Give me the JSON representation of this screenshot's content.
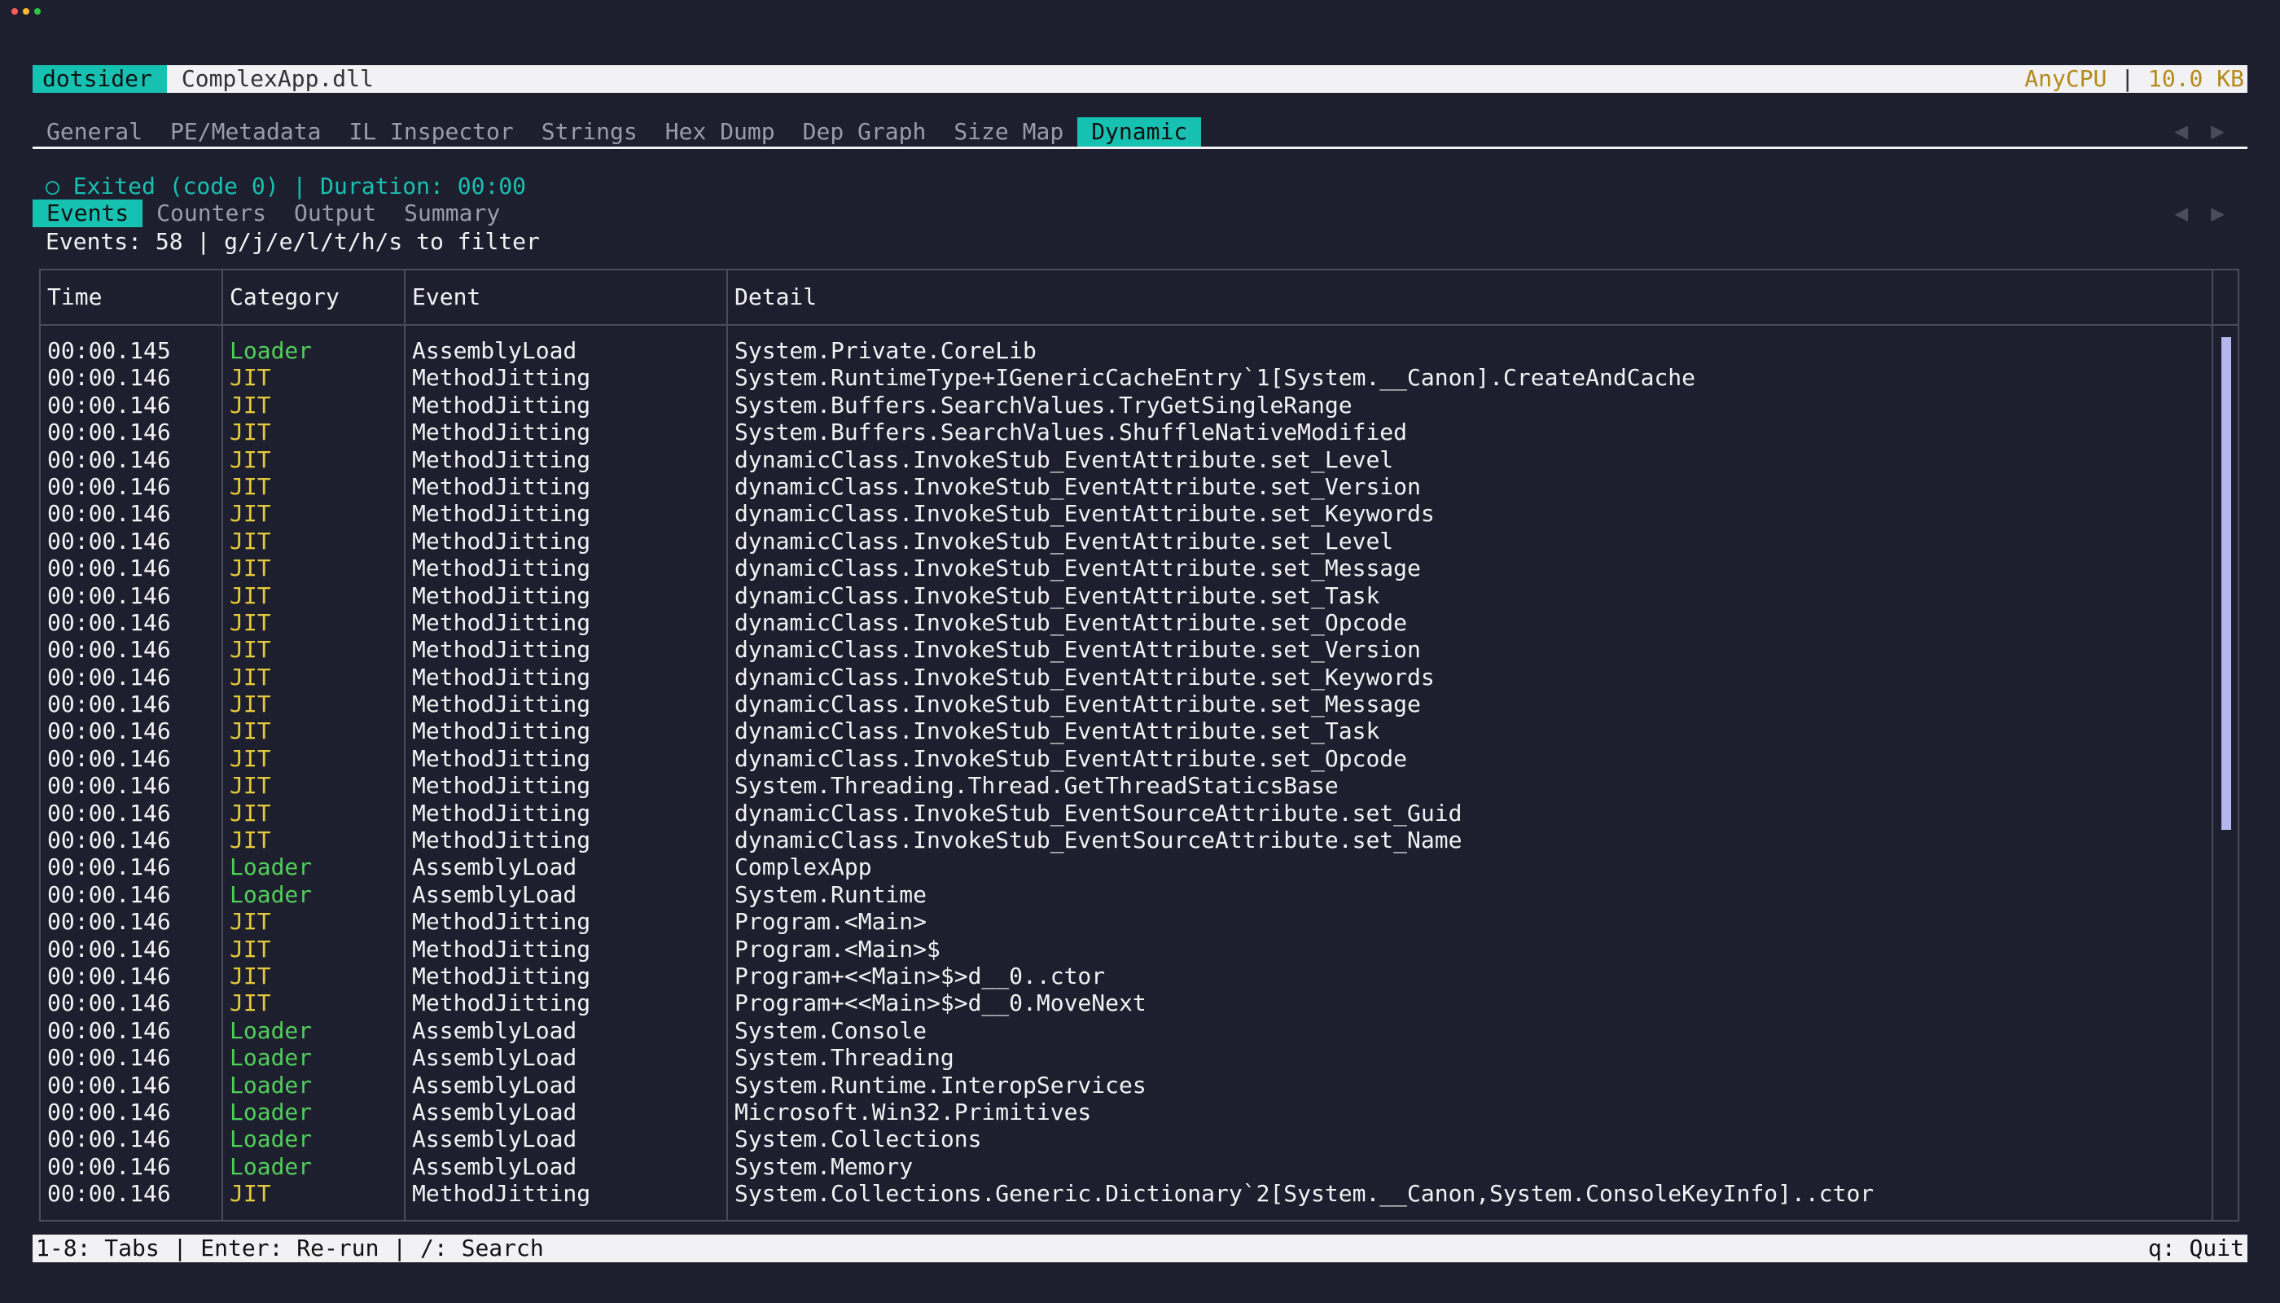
{
  "window": {
    "lights": [
      {
        "name": "close",
        "color": "#ff5f57"
      },
      {
        "name": "minimize",
        "color": "#febc2e"
      },
      {
        "name": "maximize",
        "color": "#28c840"
      }
    ]
  },
  "titlebar": {
    "app": "dotsider",
    "file": "ComplexApp.dll",
    "platform": "AnyCPU",
    "separator": "|",
    "size": "10.0 KB"
  },
  "tabs": [
    {
      "label": "General",
      "active": false
    },
    {
      "label": "PE/Metadata",
      "active": false
    },
    {
      "label": "IL Inspector",
      "active": false
    },
    {
      "label": "Strings",
      "active": false
    },
    {
      "label": "Hex Dump",
      "active": false
    },
    {
      "label": "Dep Graph",
      "active": false
    },
    {
      "label": "Size Map",
      "active": false
    },
    {
      "label": "Dynamic",
      "active": true
    }
  ],
  "nav_arrows": {
    "left": "◀",
    "right": "▶"
  },
  "status": "○ Exited (code 0) | Duration: 00:00",
  "subtabs": [
    {
      "label": "Events",
      "active": true
    },
    {
      "label": "Counters",
      "active": false
    },
    {
      "label": "Output",
      "active": false
    },
    {
      "label": "Summary",
      "active": false
    }
  ],
  "events_info": "Events: 58 | g/j/e/l/t/h/s to filter",
  "table": {
    "headers": {
      "time": "Time",
      "category": "Category",
      "event": "Event",
      "detail": "Detail"
    },
    "rows": [
      [
        "00:00.145",
        "Loader",
        "AssemblyLoad",
        "System.Private.CoreLib"
      ],
      [
        "00:00.146",
        "JIT",
        "MethodJitting",
        "System.RuntimeType+IGenericCacheEntry`1[System.__Canon].CreateAndCache"
      ],
      [
        "00:00.146",
        "JIT",
        "MethodJitting",
        "System.Buffers.SearchValues.TryGetSingleRange"
      ],
      [
        "00:00.146",
        "JIT",
        "MethodJitting",
        "System.Buffers.SearchValues.ShuffleNativeModified"
      ],
      [
        "00:00.146",
        "JIT",
        "MethodJitting",
        "dynamicClass.InvokeStub_EventAttribute.set_Level"
      ],
      [
        "00:00.146",
        "JIT",
        "MethodJitting",
        "dynamicClass.InvokeStub_EventAttribute.set_Version"
      ],
      [
        "00:00.146",
        "JIT",
        "MethodJitting",
        "dynamicClass.InvokeStub_EventAttribute.set_Keywords"
      ],
      [
        "00:00.146",
        "JIT",
        "MethodJitting",
        "dynamicClass.InvokeStub_EventAttribute.set_Level"
      ],
      [
        "00:00.146",
        "JIT",
        "MethodJitting",
        "dynamicClass.InvokeStub_EventAttribute.set_Message"
      ],
      [
        "00:00.146",
        "JIT",
        "MethodJitting",
        "dynamicClass.InvokeStub_EventAttribute.set_Task"
      ],
      [
        "00:00.146",
        "JIT",
        "MethodJitting",
        "dynamicClass.InvokeStub_EventAttribute.set_Opcode"
      ],
      [
        "00:00.146",
        "JIT",
        "MethodJitting",
        "dynamicClass.InvokeStub_EventAttribute.set_Version"
      ],
      [
        "00:00.146",
        "JIT",
        "MethodJitting",
        "dynamicClass.InvokeStub_EventAttribute.set_Keywords"
      ],
      [
        "00:00.146",
        "JIT",
        "MethodJitting",
        "dynamicClass.InvokeStub_EventAttribute.set_Message"
      ],
      [
        "00:00.146",
        "JIT",
        "MethodJitting",
        "dynamicClass.InvokeStub_EventAttribute.set_Task"
      ],
      [
        "00:00.146",
        "JIT",
        "MethodJitting",
        "dynamicClass.InvokeStub_EventAttribute.set_Opcode"
      ],
      [
        "00:00.146",
        "JIT",
        "MethodJitting",
        "System.Threading.Thread.GetThreadStaticsBase"
      ],
      [
        "00:00.146",
        "JIT",
        "MethodJitting",
        "dynamicClass.InvokeStub_EventSourceAttribute.set_Guid"
      ],
      [
        "00:00.146",
        "JIT",
        "MethodJitting",
        "dynamicClass.InvokeStub_EventSourceAttribute.set_Name"
      ],
      [
        "00:00.146",
        "Loader",
        "AssemblyLoad",
        "ComplexApp"
      ],
      [
        "00:00.146",
        "Loader",
        "AssemblyLoad",
        "System.Runtime"
      ],
      [
        "00:00.146",
        "JIT",
        "MethodJitting",
        "Program.<Main>"
      ],
      [
        "00:00.146",
        "JIT",
        "MethodJitting",
        "Program.<Main>$"
      ],
      [
        "00:00.146",
        "JIT",
        "MethodJitting",
        "Program+<<Main>$>d__0..ctor"
      ],
      [
        "00:00.146",
        "JIT",
        "MethodJitting",
        "Program+<<Main>$>d__0.MoveNext"
      ],
      [
        "00:00.146",
        "Loader",
        "AssemblyLoad",
        "System.Console"
      ],
      [
        "00:00.146",
        "Loader",
        "AssemblyLoad",
        "System.Threading"
      ],
      [
        "00:00.146",
        "Loader",
        "AssemblyLoad",
        "System.Runtime.InteropServices"
      ],
      [
        "00:00.146",
        "Loader",
        "AssemblyLoad",
        "Microsoft.Win32.Primitives"
      ],
      [
        "00:00.146",
        "Loader",
        "AssemblyLoad",
        "System.Collections"
      ],
      [
        "00:00.146",
        "Loader",
        "AssemblyLoad",
        "System.Memory"
      ],
      [
        "00:00.146",
        "JIT",
        "MethodJitting",
        "System.Collections.Generic.Dictionary`2[System.__Canon,System.ConsoleKeyInfo]..ctor"
      ]
    ]
  },
  "footer": {
    "left": "1-8: Tabs | Enter: Re-run | /: Search",
    "right": "q: Quit"
  },
  "colors": {
    "accent": "#17c1b2",
    "loader": "#4fcf5a",
    "jit": "#e5c93a",
    "background": "#1e1f2e",
    "size_gold": "#b38a1c"
  }
}
